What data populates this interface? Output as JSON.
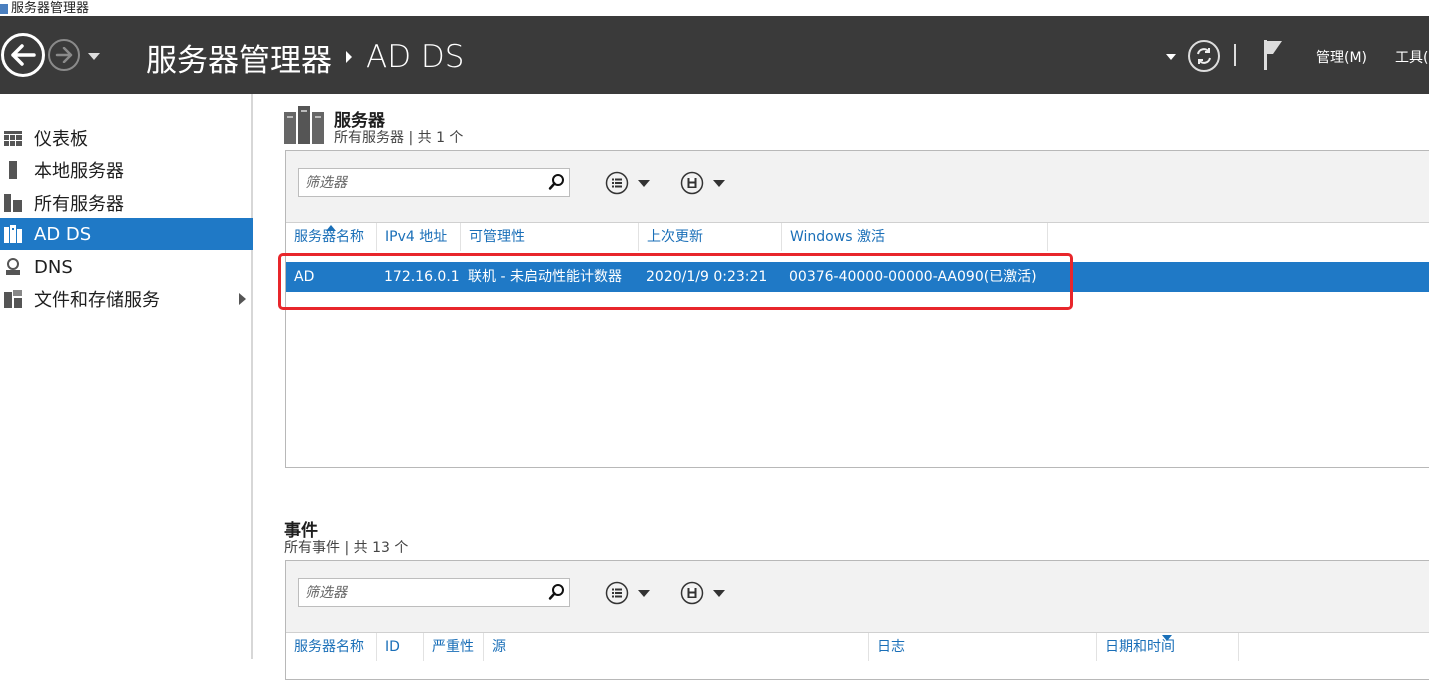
{
  "window": {
    "title": "服务器管理器"
  },
  "header": {
    "breadcrumb_root": "服务器管理器",
    "breadcrumb_current": "AD DS",
    "menu_manage": "管理(M)",
    "menu_tools": "工具("
  },
  "sidebar": {
    "items": [
      {
        "label": "仪表板",
        "icon": "dashboard-icon"
      },
      {
        "label": "本地服务器",
        "icon": "local-server-icon"
      },
      {
        "label": "所有服务器",
        "icon": "all-servers-icon"
      },
      {
        "label": "AD DS",
        "icon": "ad-ds-icon"
      },
      {
        "label": "DNS",
        "icon": "dns-icon"
      },
      {
        "label": "文件和存储服务",
        "icon": "file-storage-icon"
      }
    ],
    "selected": "AD DS"
  },
  "servers": {
    "title": "服务器",
    "subtitle": "所有服务器 | 共 1 个",
    "filter_placeholder": "筛选器",
    "columns": [
      "服务器名称",
      "IPv4 地址",
      "可管理性",
      "上次更新",
      "Windows 激活"
    ],
    "rows": [
      {
        "name": "AD",
        "ipv4": "172.16.0.1",
        "manageability": "联机 - 未启动性能计数器",
        "last_update": "2020/1/9 0:23:21",
        "activation": "00376-40000-00000-AA090(已激活)"
      }
    ]
  },
  "events": {
    "title": "事件",
    "subtitle": "所有事件 | 共 13 个",
    "filter_placeholder": "筛选器",
    "columns": [
      "服务器名称",
      "ID",
      "严重性",
      "源",
      "日志",
      "日期和时间"
    ]
  },
  "colors": {
    "accent": "#1f79c6",
    "header_bg": "#3a3a3a",
    "highlight": "#e8262b"
  }
}
